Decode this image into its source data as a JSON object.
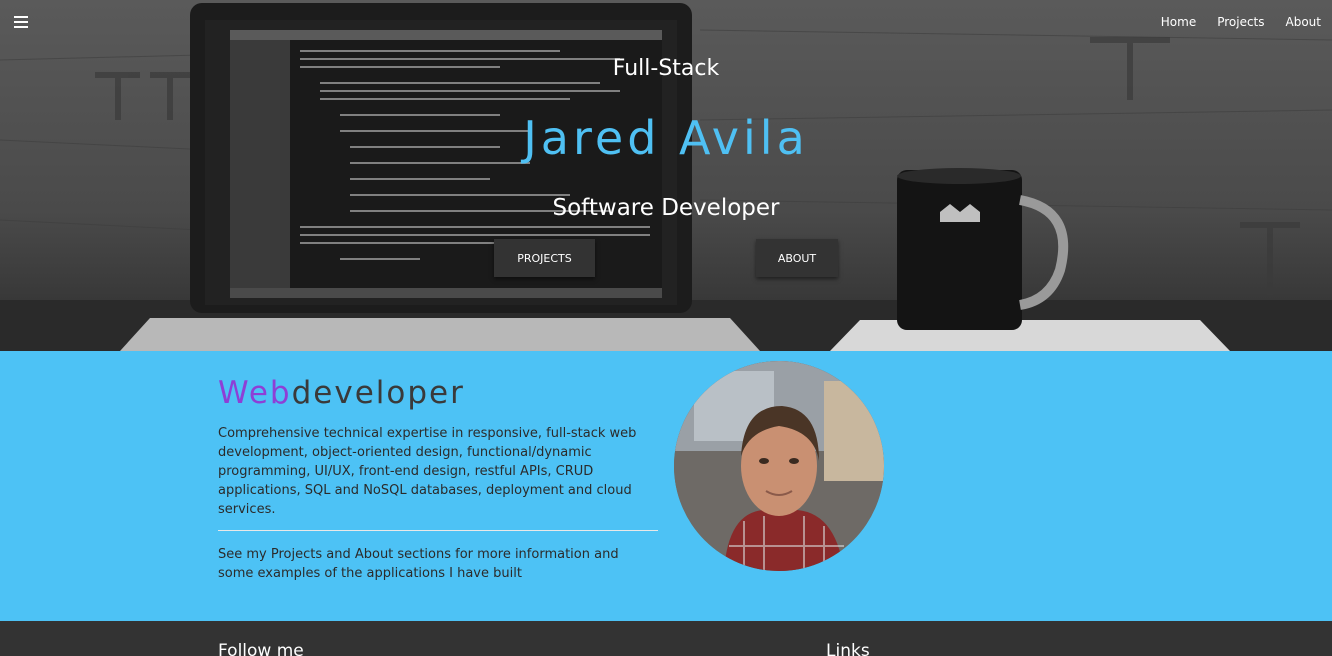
{
  "nav": {
    "menu_icon": "hamburger-icon",
    "links": [
      "Home",
      "Projects",
      "About"
    ]
  },
  "hero": {
    "line1": "Full-Stack",
    "name": "Jared Avila",
    "line2": "Software Developer",
    "buttons": [
      "PROJECTS",
      "ABOUT"
    ],
    "name_color": "#4fc0f3"
  },
  "intro": {
    "title_part1": "Web",
    "title_part2": "developer",
    "paragraph1": "Comprehensive technical expertise in responsive, full-stack web development, object-oriented design, functional/dynamic programming, UI/UX, front-end design, restful APIs, CRUD applications, SQL and NoSQL databases, deployment and cloud services.",
    "paragraph2": "See my Projects and About sections for more information and some examples of the applications I have built",
    "background": "#4dc2f5",
    "accent": "#8e3fd6"
  },
  "footer": {
    "headings": [
      "Follow me",
      "Links"
    ]
  }
}
